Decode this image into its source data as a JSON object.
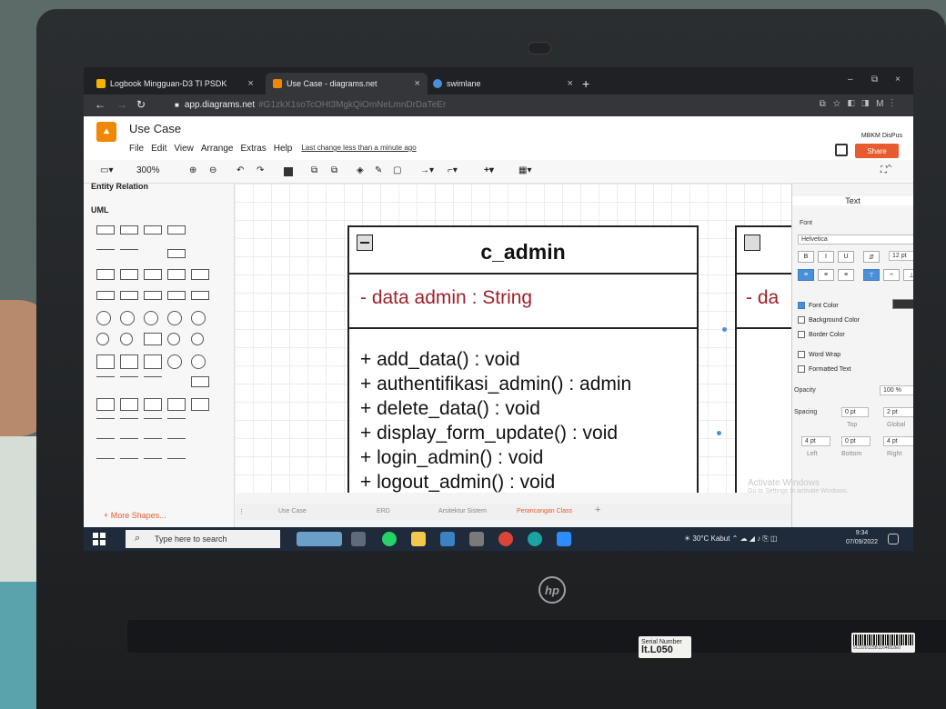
{
  "browser": {
    "tabs": [
      {
        "label": "Logbook Mingguan-D3 TI PSDK",
        "close": "×"
      },
      {
        "label": "Use Case - diagrams.net",
        "close": "×"
      },
      {
        "label": "swimlane",
        "close": "×"
      }
    ],
    "new_tab": "+",
    "url_host": "app.diagrams.net",
    "url_rest": "#G1zkX1soTcOHt3MgkQiOmNeLmnDrDaTeEr",
    "window_controls": [
      "–",
      "⧉",
      "×"
    ]
  },
  "drawio": {
    "title": "Use Case",
    "menu": [
      "File",
      "Edit",
      "View",
      "Arrange",
      "Extras",
      "Help"
    ],
    "last_change": "Last change less than a minute ago",
    "user": "MBKM DisPus",
    "share_label": "Share",
    "zoom": "300%"
  },
  "sidebar": {
    "entity_relation": "Entity Relation",
    "uml": "UML",
    "more_shapes": "+ More Shapes..."
  },
  "diagram": {
    "class_name": "c_admin",
    "attribute": "- data admin : String",
    "operations": [
      "+ add_data() : void",
      "+ authentifikasi_admin() : admin",
      "+ delete_data() : void",
      "+ display_form_update() : void",
      "+ login_admin() : void",
      "+ logout_admin() : void"
    ],
    "second_class_attribute": "- da"
  },
  "page_tabs": [
    "Use Case",
    "ERD",
    "Arsitektur Sistem",
    "Perancangan Class"
  ],
  "page_add": "+",
  "format_panel": {
    "title": "Text",
    "font_label": "Font",
    "font_value": "Helvetica",
    "font_size": "12 pt",
    "font_color": "Font Color",
    "background_color": "Background Color",
    "border_color": "Border Color",
    "word_wrap": "Word Wrap",
    "formatted_text": "Formatted Text",
    "opacity_label": "Opacity",
    "opacity_value": "100 %",
    "spacing_label": "Spacing",
    "spacing_top": "0 pt",
    "spacing_global": "2 pt",
    "top_label": "Top",
    "global_label": "Global",
    "spacing_left": "4 pt",
    "spacing_bottom": "0 pt",
    "spacing_right": "4 pt",
    "left_label": "Left",
    "bottom_label": "Bottom",
    "right_label": "Right",
    "style_buttons": [
      "B",
      "I",
      "U"
    ]
  },
  "windows_watermark": {
    "line1": "Activate Windows",
    "line2": "Go to Settings to activate Windows."
  },
  "taskbar": {
    "search_placeholder": "Type here to search",
    "weather": "30°C  Kabut",
    "time": "9:34",
    "date": "07/09/2022"
  },
  "hardware": {
    "brand": "hp",
    "sticker_line": "Serial Number",
    "sticker_big": "lt.L050",
    "barcode_number": "5CD20115B1164652E0"
  },
  "colors": {
    "drawio_orange": "#f08705",
    "share_orange": "#e65c2e",
    "attribute_red": "#a0202a",
    "selection_blue": "#4a90d9"
  }
}
